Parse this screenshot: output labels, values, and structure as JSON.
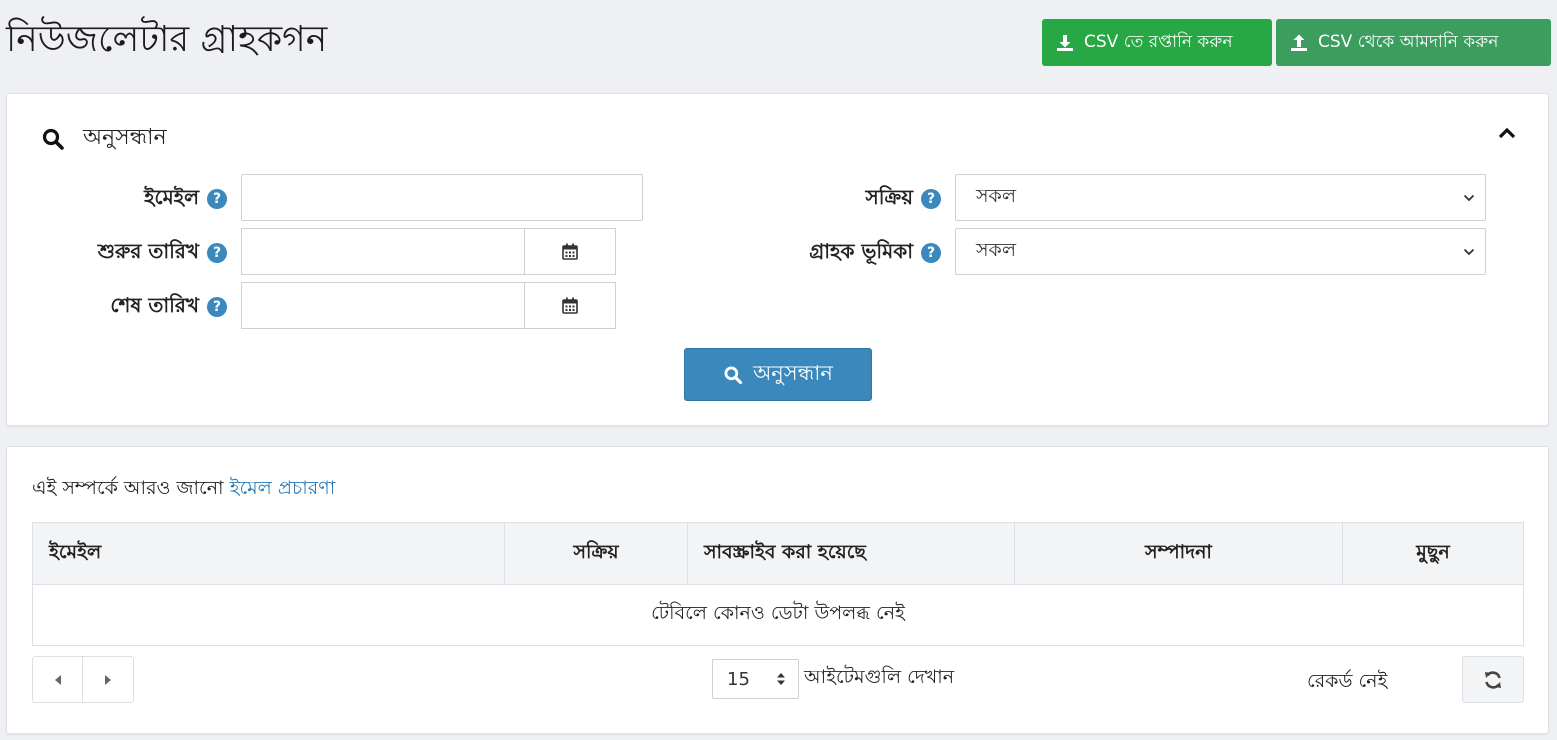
{
  "page": {
    "title": "নিউজলেটার গ্রাহকগন"
  },
  "toolbar": {
    "export_label": "CSV তে রপ্তানি করুন",
    "import_label": "CSV থেকে আমদানি করুন"
  },
  "search": {
    "heading": "অনুসন্ধান",
    "email_label": "ইমেইল",
    "email_value": "",
    "start_date_label": "শুরুর তারিখ",
    "start_date_value": "",
    "end_date_label": "শেষ তারিখ",
    "end_date_value": "",
    "active_label": "সক্রিয়",
    "active_selected": "সকল",
    "role_label": "গ্রাহক ভূমিকা",
    "role_selected": "সকল",
    "help_glyph": "?",
    "button_label": "অনুসন্ধান"
  },
  "list": {
    "learn_more_text": "এই সম্পর্কে আরও জানো",
    "learn_more_link": "ইমেল প্রচারণা",
    "columns": [
      "ইমেইল",
      "সক্রিয়",
      "সাবস্ক্রাইব করা হয়েছে",
      "সম্পাদনা",
      "মুছুন"
    ],
    "empty_message": "টেবিলে কোনও ডেটা উপলব্ধ নেই",
    "page_size": "15",
    "page_size_label": "আইটেমগুলি দেখান",
    "records_text": "রেকর্ড নেই"
  },
  "colors": {
    "accent_blue": "#3b88bd",
    "export_green": "#27a844",
    "import_green": "#3b9e5e",
    "link_blue": "#2a7ab8"
  },
  "icons": [
    "download-icon",
    "upload-icon",
    "search-icon",
    "chevron-up-icon",
    "help-icon",
    "calendar-icon",
    "chevron-down-icon",
    "caret-left-icon",
    "caret-right-icon",
    "sort-icon",
    "refresh-icon"
  ]
}
